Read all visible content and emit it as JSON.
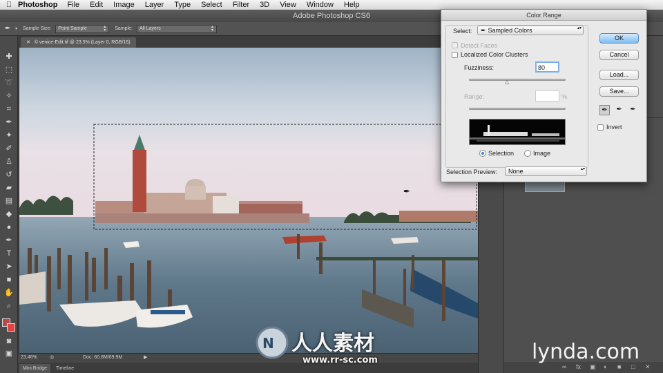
{
  "menubar": {
    "app": "Photoshop",
    "items": [
      "File",
      "Edit",
      "Image",
      "Layer",
      "Type",
      "Select",
      "Filter",
      "3D",
      "View",
      "Window",
      "Help"
    ]
  },
  "window_title": "Adobe Photoshop CS6",
  "options_bar": {
    "sample_size_label": "Sample Size:",
    "sample_size_value": "Point Sample",
    "sample_label": "Sample:",
    "sample_value": "All Layers"
  },
  "document": {
    "tab_title": "© venice-Edit.tif @ 23.5% (Layer 0, RGB/16)",
    "zoom": "23.46%",
    "doc_size": "Doc: 60.8M/69.9M"
  },
  "bottom_tabs": [
    "Mini Bridge",
    "Timeline"
  ],
  "dialog": {
    "title": "Color Range",
    "select_label": "Select:",
    "select_value": "Sampled Colors",
    "detect_faces": "Detect Faces",
    "localized": "Localized Color Clusters",
    "fuzziness_label": "Fuzziness:",
    "fuzziness_value": "80",
    "range_label": "Range:",
    "range_unit": "%",
    "radio_selection": "Selection",
    "radio_image": "Image",
    "preview_label": "Selection Preview:",
    "preview_value": "None",
    "buttons": {
      "ok": "OK",
      "cancel": "Cancel",
      "load": "Load...",
      "save": "Save..."
    },
    "invert": "Invert"
  },
  "watermark": {
    "cn": "人人素材",
    "url": "www.rr-sc.com",
    "brand": "lynda.com"
  },
  "colors": {
    "dialog_bg": "#e9e9e9",
    "ok_button": "#7fbcf0",
    "ps_chrome": "#535353"
  },
  "icons": [
    "apple-icon",
    "eyedropper-icon",
    "move-icon",
    "marquee-icon",
    "lasso-icon",
    "quick-select-icon",
    "crop-icon",
    "brush-icon",
    "hand-icon",
    "zoom-icon",
    "eyedropper-plus-icon",
    "eyedropper-minus-icon"
  ]
}
